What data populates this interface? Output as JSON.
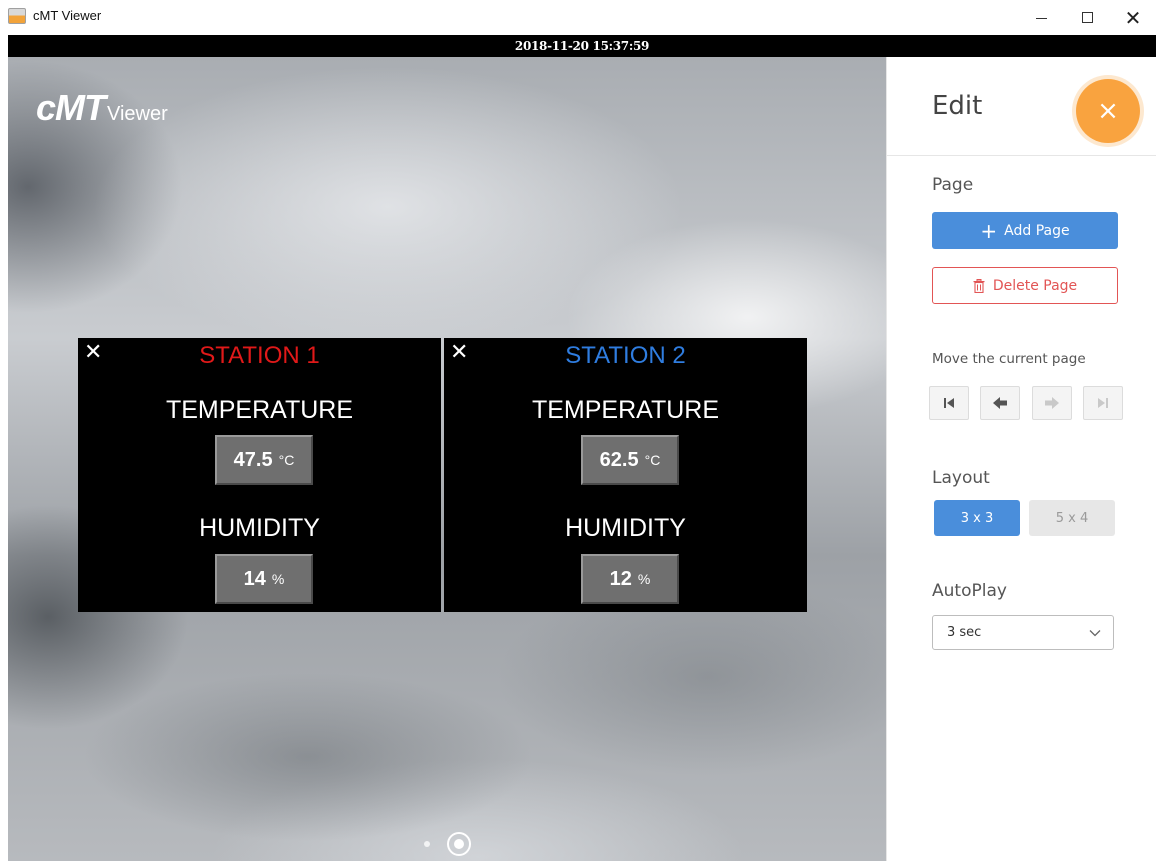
{
  "window": {
    "title": "cMT Viewer",
    "minimize_glyph": "—",
    "maximize_glyph": "☐",
    "close_glyph": "✕"
  },
  "timestamp": "2018-11-20 15:37:59",
  "logo": {
    "main": "cMT",
    "sub": "Viewer"
  },
  "stations": [
    {
      "name": "STATION 1",
      "title_color": "#e01919",
      "temperature_label": "TEMPERATURE",
      "temperature_value": "47.5",
      "temperature_unit": "°C",
      "humidity_label": "HUMIDITY",
      "humidity_value": "14",
      "humidity_unit": "%"
    },
    {
      "name": "STATION 2",
      "title_color": "#2f7de0",
      "temperature_label": "TEMPERATURE",
      "temperature_value": "62.5",
      "temperature_unit": "°C",
      "humidity_label": "HUMIDITY",
      "humidity_value": "12",
      "humidity_unit": "%"
    }
  ],
  "page_indicator": {
    "total": 2,
    "current": 2
  },
  "edit": {
    "title": "Edit",
    "close_glyph": "×",
    "page_section": "Page",
    "add_page": "Add Page",
    "delete_page": "Delete Page",
    "move_label": "Move the current page",
    "layout_section": "Layout",
    "layout_options": [
      "3 x 3",
      "5 x 4"
    ],
    "layout_selected": "3 x 3",
    "autoplay_section": "AutoPlay",
    "autoplay_value": "3 sec"
  },
  "colors": {
    "accent_blue": "#4a8edb",
    "fab_orange": "#f9a33f",
    "delete_red": "#e25555"
  },
  "icons": {
    "add": "plus-icon",
    "delete": "trash-icon",
    "first": "skip-first-icon",
    "prev": "arrow-left-icon",
    "next": "arrow-right-icon",
    "last": "skip-last-icon",
    "dropdown": "chevron-down-icon"
  }
}
